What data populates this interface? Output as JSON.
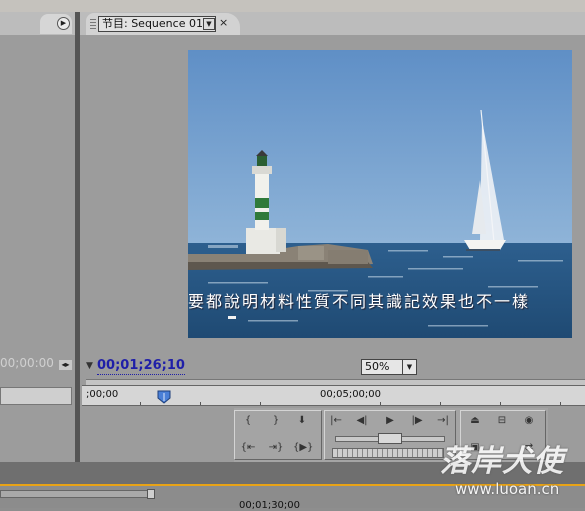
{
  "left_panel": {
    "timecode": "00;00:00"
  },
  "program_monitor": {
    "tab_label": "节目: Sequence 01",
    "tab_close": "×",
    "subtitle": "要都說明材料性質不同其識記效果也不一樣",
    "current_timecode": "00;01;26;10",
    "zoom_value": "50%",
    "ruler": {
      "start_label": ";00;00",
      "mid_label": "00;05;00;00"
    }
  },
  "bottom": {
    "timecode": "00;01;30;00"
  },
  "watermark": {
    "text": "落岸犬使",
    "url": "www.luoan.cn"
  },
  "colors": {
    "timecode_blue": "#1f1fa8",
    "work_area_orange": "#e8a317",
    "panel_gray": "#9c9c9c"
  },
  "icons": [
    "panel-menu-icon",
    "tab-dropdown-icon",
    "close-icon",
    "playhead-icon",
    "mark-in-icon",
    "mark-out-icon",
    "set-marker-icon",
    "go-to-in-icon",
    "go-to-out-icon",
    "play-in-to-out-icon",
    "step-back-icon",
    "step-back-frame-icon",
    "play-icon",
    "step-forward-frame-icon",
    "step-forward-icon",
    "lift-icon",
    "extract-icon",
    "export-frame-icon",
    "output-icon"
  ]
}
